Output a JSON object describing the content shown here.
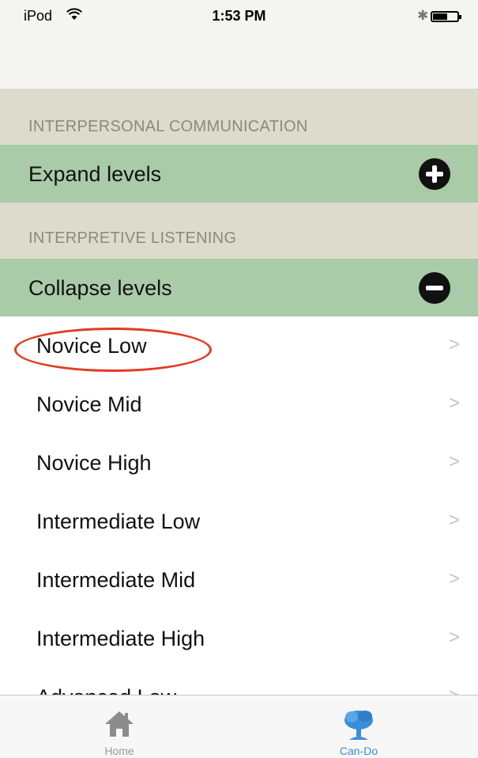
{
  "status_bar": {
    "carrier": "iPod",
    "time": "1:53 PM"
  },
  "sections": [
    {
      "header": "INTERPERSONAL COMMUNICATION",
      "toggle_label": "Expand levels",
      "toggle_icon": "plus-circle-icon"
    },
    {
      "header": "INTERPRETIVE LISTENING",
      "toggle_label": "Collapse levels",
      "toggle_icon": "minus-circle-icon"
    }
  ],
  "levels": [
    {
      "label": "Novice Low",
      "chevron": ">"
    },
    {
      "label": "Novice Mid",
      "chevron": ">"
    },
    {
      "label": "Novice High",
      "chevron": ">"
    },
    {
      "label": "Intermediate Low",
      "chevron": ">"
    },
    {
      "label": "Intermediate Mid",
      "chevron": ">"
    },
    {
      "label": "Intermediate High",
      "chevron": ">"
    },
    {
      "label": "Advanced Low",
      "chevron": ">"
    }
  ],
  "tabs": [
    {
      "label": "Home",
      "icon": "home-icon",
      "selected": false
    },
    {
      "label": "Can-Do",
      "icon": "tree-icon",
      "selected": true
    }
  ],
  "colors": {
    "section_header_bg": "#dddbcb",
    "toggle_row_bg": "#a9cba7",
    "highlight": "#e23b22",
    "tab_selected": "#3b8fd8"
  }
}
